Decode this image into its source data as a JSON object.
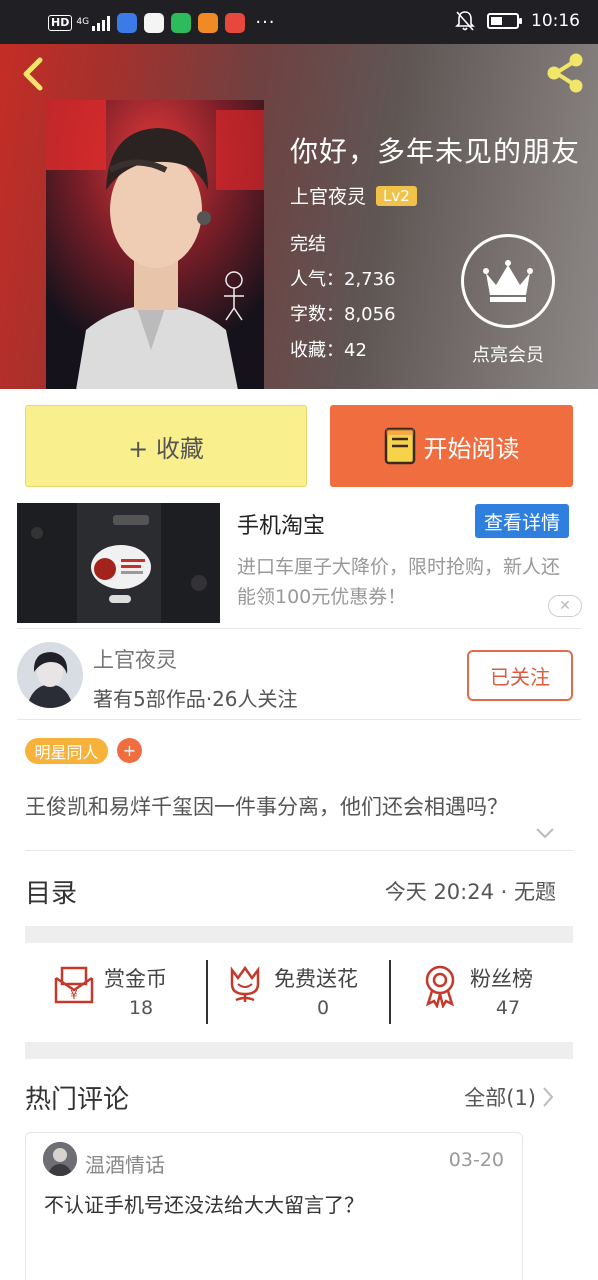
{
  "status_bar": {
    "network_badge": "HD",
    "network_type": "4G",
    "more": "···",
    "time": "10:16"
  },
  "book": {
    "title": "你好，多年未见的朋友",
    "author": "上官夜灵",
    "author_level": "Lv2",
    "status": "完结",
    "popularity_label": "人气：",
    "popularity": "2,736",
    "word_count_label": "字数：",
    "word_count": "8,056",
    "favorites_label": "收藏：",
    "favorites": "42",
    "vip_label": "点亮会员"
  },
  "actions": {
    "collect": "+ 收藏",
    "read": "开始阅读"
  },
  "ad": {
    "title": "手机淘宝",
    "details_button": "查看详情",
    "description": "进口车厘子大降价，限时抢购，新人还能领100元优惠券！",
    "close": "✕"
  },
  "author_info": {
    "name": "上官夜灵",
    "stats": "著有5部作品·26人关注",
    "follow_button": "已关注"
  },
  "tags": {
    "primary": "明星同人",
    "add": "+"
  },
  "synopsis": "王俊凯和易烊千玺因一件事分离，他们还会相遇吗？",
  "toc": {
    "label": "目录",
    "latest": "今天 20:24 · 无题"
  },
  "stats": [
    {
      "label": "赏金币",
      "value": "18"
    },
    {
      "label": "免费送花",
      "value": "0"
    },
    {
      "label": "粉丝榜",
      "value": "47"
    }
  ],
  "comments": {
    "section_title": "热门评论",
    "all_link": "全部(1)",
    "items": [
      {
        "user": "温酒情话",
        "date": "03-20",
        "text": "不认证手机号还没法给大大留言了？"
      }
    ]
  },
  "colors": {
    "accent_orange": "#ef6d3f",
    "collect_yellow": "#f9ef8d",
    "level_gold": "#f0c24a",
    "link_blue": "#2f7fdf",
    "follow_red": "#e05b3d"
  }
}
